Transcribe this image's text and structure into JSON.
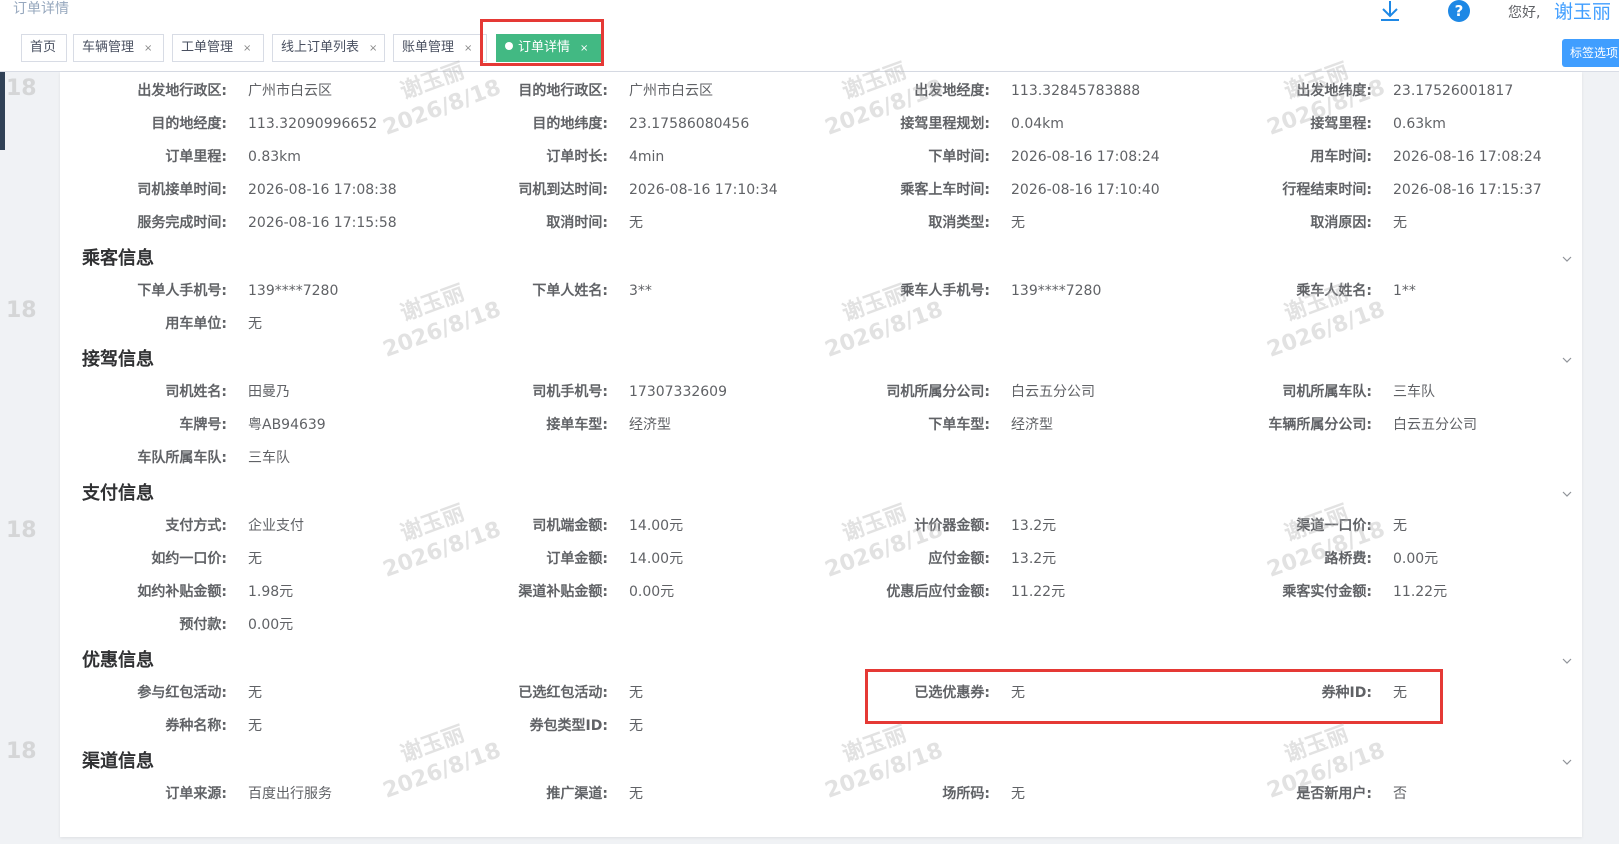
{
  "header": {
    "page_title": "订单详情",
    "greeting": "您好,",
    "username": "谢玉丽",
    "icons": [
      "download-icon",
      "help-icon"
    ]
  },
  "tags": [
    {
      "label": "首页",
      "closable": false
    },
    {
      "label": "车辆管理",
      "closable": true
    },
    {
      "label": "工单管理",
      "closable": true
    },
    {
      "label": "线上订单列表",
      "closable": true
    },
    {
      "label": "账单管理",
      "closable": true
    },
    {
      "label": "订单详情",
      "closable": true,
      "active": true
    }
  ],
  "tag_close_glyph": "×",
  "tag_select_label": "标签选项",
  "watermark": {
    "name": "谢玉丽",
    "date": "2026/8/18",
    "edge": "18"
  },
  "colors": {
    "active_tag": "#42b983",
    "highlight": "#e53935",
    "primary": "#409eff"
  },
  "sections": [
    {
      "title": "",
      "rows": [
        [
          [
            "出发地行政区:",
            "广州市白云区"
          ],
          [
            "目的地行政区:",
            "广州市白云区"
          ],
          [
            "出发地经度:",
            "113.32845783888"
          ],
          [
            "出发地纬度:",
            "23.17526001817"
          ]
        ],
        [
          [
            "目的地经度:",
            "113.32090996652"
          ],
          [
            "目的地纬度:",
            "23.17586080456"
          ],
          [
            "接驾里程规划:",
            "0.04km"
          ],
          [
            "接驾里程:",
            "0.63km"
          ]
        ],
        [
          [
            "订单里程:",
            "0.83km"
          ],
          [
            "订单时长:",
            "4min"
          ],
          [
            "下单时间:",
            "2026-08-16 17:08:24"
          ],
          [
            "用车时间:",
            "2026-08-16 17:08:24"
          ]
        ],
        [
          [
            "司机接单时间:",
            "2026-08-16 17:08:38"
          ],
          [
            "司机到达时间:",
            "2026-08-16 17:10:34"
          ],
          [
            "乘客上车时间:",
            "2026-08-16 17:10:40"
          ],
          [
            "行程结束时间:",
            "2026-08-16 17:15:37"
          ]
        ],
        [
          [
            "服务完成时间:",
            "2026-08-16 17:15:58"
          ],
          [
            "取消时间:",
            "无"
          ],
          [
            "取消类型:",
            "无"
          ],
          [
            "取消原因:",
            "无"
          ]
        ]
      ]
    },
    {
      "title": "乘客信息",
      "rows": [
        [
          [
            "下单人手机号:",
            "139****7280"
          ],
          [
            "下单人姓名:",
            "3**"
          ],
          [
            "乘车人手机号:",
            "139****7280"
          ],
          [
            "乘车人姓名:",
            "1**"
          ]
        ],
        [
          [
            "用车单位:",
            "无"
          ]
        ]
      ]
    },
    {
      "title": "接驾信息",
      "rows": [
        [
          [
            "司机姓名:",
            "田曼乃"
          ],
          [
            "司机手机号:",
            "17307332609"
          ],
          [
            "司机所属分公司:",
            "白云五分公司"
          ],
          [
            "司机所属车队:",
            "三车队"
          ]
        ],
        [
          [
            "车牌号:",
            "粤AB94639"
          ],
          [
            "接单车型:",
            "经济型"
          ],
          [
            "下单车型:",
            "经济型"
          ],
          [
            "车辆所属分公司:",
            "白云五分公司"
          ]
        ],
        [
          [
            "车队所属车队:",
            "三车队"
          ]
        ]
      ]
    },
    {
      "title": "支付信息",
      "rows": [
        [
          [
            "支付方式:",
            "企业支付"
          ],
          [
            "司机端金额:",
            "14.00元"
          ],
          [
            "计价器金额:",
            "13.2元"
          ],
          [
            "渠道一口价:",
            "无"
          ]
        ],
        [
          [
            "如约一口价:",
            "无"
          ],
          [
            "订单金额:",
            "14.00元"
          ],
          [
            "应付金额:",
            "13.2元"
          ],
          [
            "路桥费:",
            "0.00元"
          ]
        ],
        [
          [
            "如约补贴金额:",
            "1.98元"
          ],
          [
            "渠道补贴金额:",
            "0.00元"
          ],
          [
            "优惠后应付金额:",
            "11.22元"
          ],
          [
            "乘客实付金额:",
            "11.22元"
          ]
        ],
        [
          [
            "预付款:",
            "0.00元"
          ]
        ]
      ]
    },
    {
      "title": "优惠信息",
      "rows": [
        [
          [
            "参与红包活动:",
            "无"
          ],
          [
            "已选红包活动:",
            "无"
          ],
          [
            "已选优惠券:",
            "无"
          ],
          [
            "券种ID:",
            "无"
          ]
        ],
        [
          [
            "券种名称:",
            "无"
          ],
          [
            "券包类型ID:",
            "无"
          ]
        ]
      ]
    },
    {
      "title": "渠道信息",
      "rows": [
        [
          [
            "订单来源:",
            "百度出行服务"
          ],
          [
            "推广渠道:",
            "无"
          ],
          [
            "场所码:",
            "无"
          ],
          [
            "是否新用户:",
            "否"
          ]
        ]
      ]
    }
  ]
}
